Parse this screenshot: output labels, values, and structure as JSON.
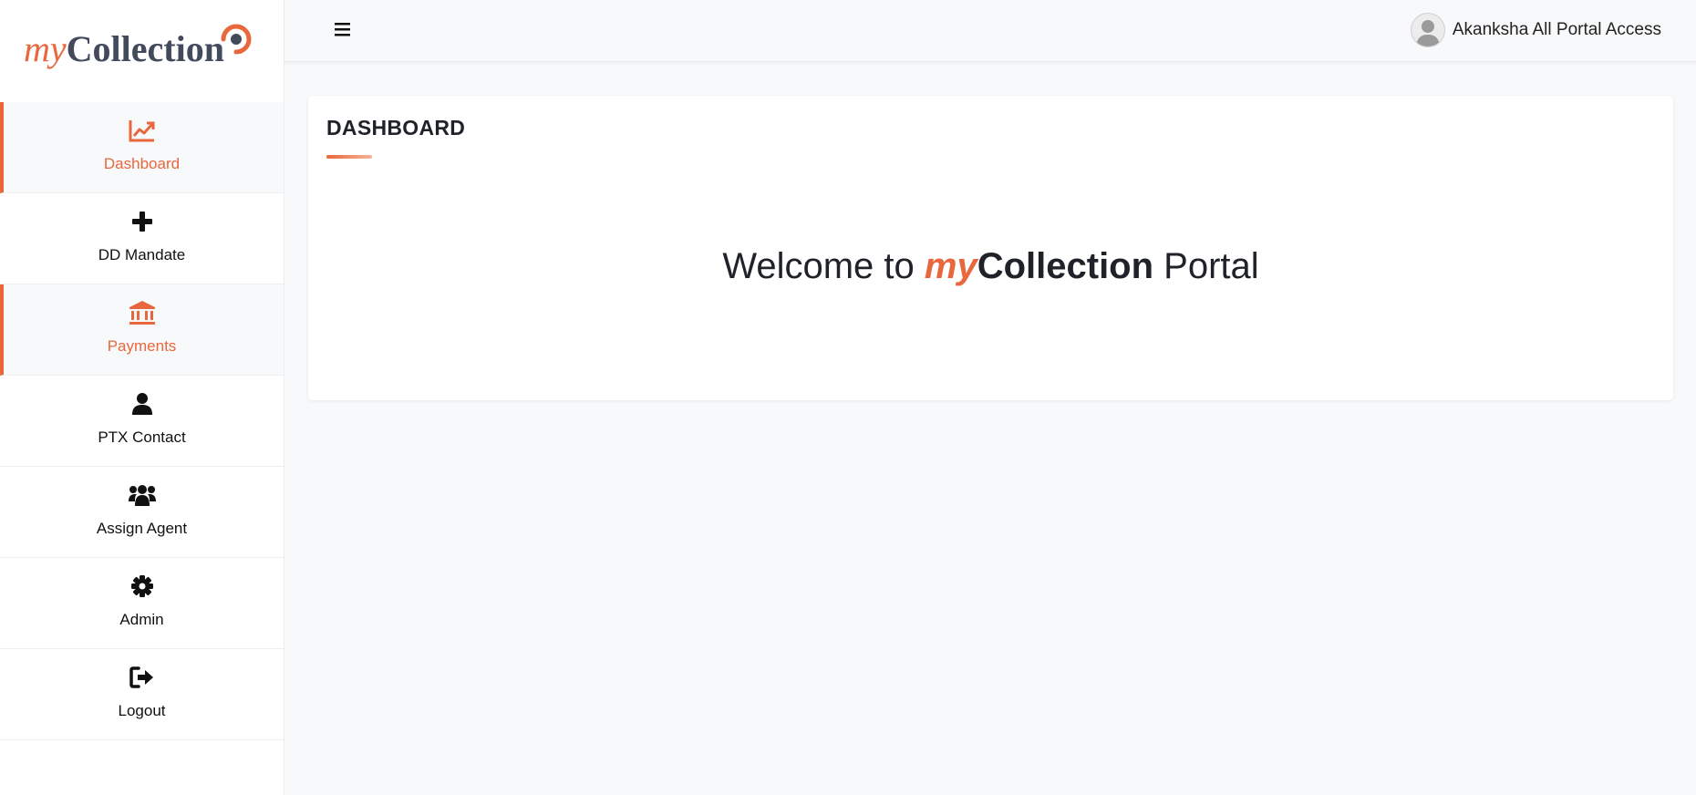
{
  "brand": {
    "logo_my": "my",
    "logo_collection": "Collection"
  },
  "colors": {
    "accent": "#e8673c",
    "logo_dark": "#424a5c"
  },
  "sidebar": {
    "items": [
      {
        "label": "Dashboard",
        "icon": "chart-line-icon",
        "active": true
      },
      {
        "label": "DD Mandate",
        "icon": "plus-icon",
        "active": false
      },
      {
        "label": "Payments",
        "icon": "bank-icon",
        "active": true
      },
      {
        "label": "PTX Contact",
        "icon": "user-icon",
        "active": false
      },
      {
        "label": "Assign Agent",
        "icon": "users-icon",
        "active": false
      },
      {
        "label": "Admin",
        "icon": "gear-icon",
        "active": false
      },
      {
        "label": "Logout",
        "icon": "sign-out-icon",
        "active": false
      }
    ]
  },
  "header": {
    "menu_icon": "hamburger-icon",
    "user_name": "Akanksha All Portal Access"
  },
  "main": {
    "card_title": "DASHBOARD",
    "welcome": {
      "prefix": "Welcome to ",
      "my": "my",
      "collection": "Collection",
      "suffix": " Portal"
    }
  }
}
